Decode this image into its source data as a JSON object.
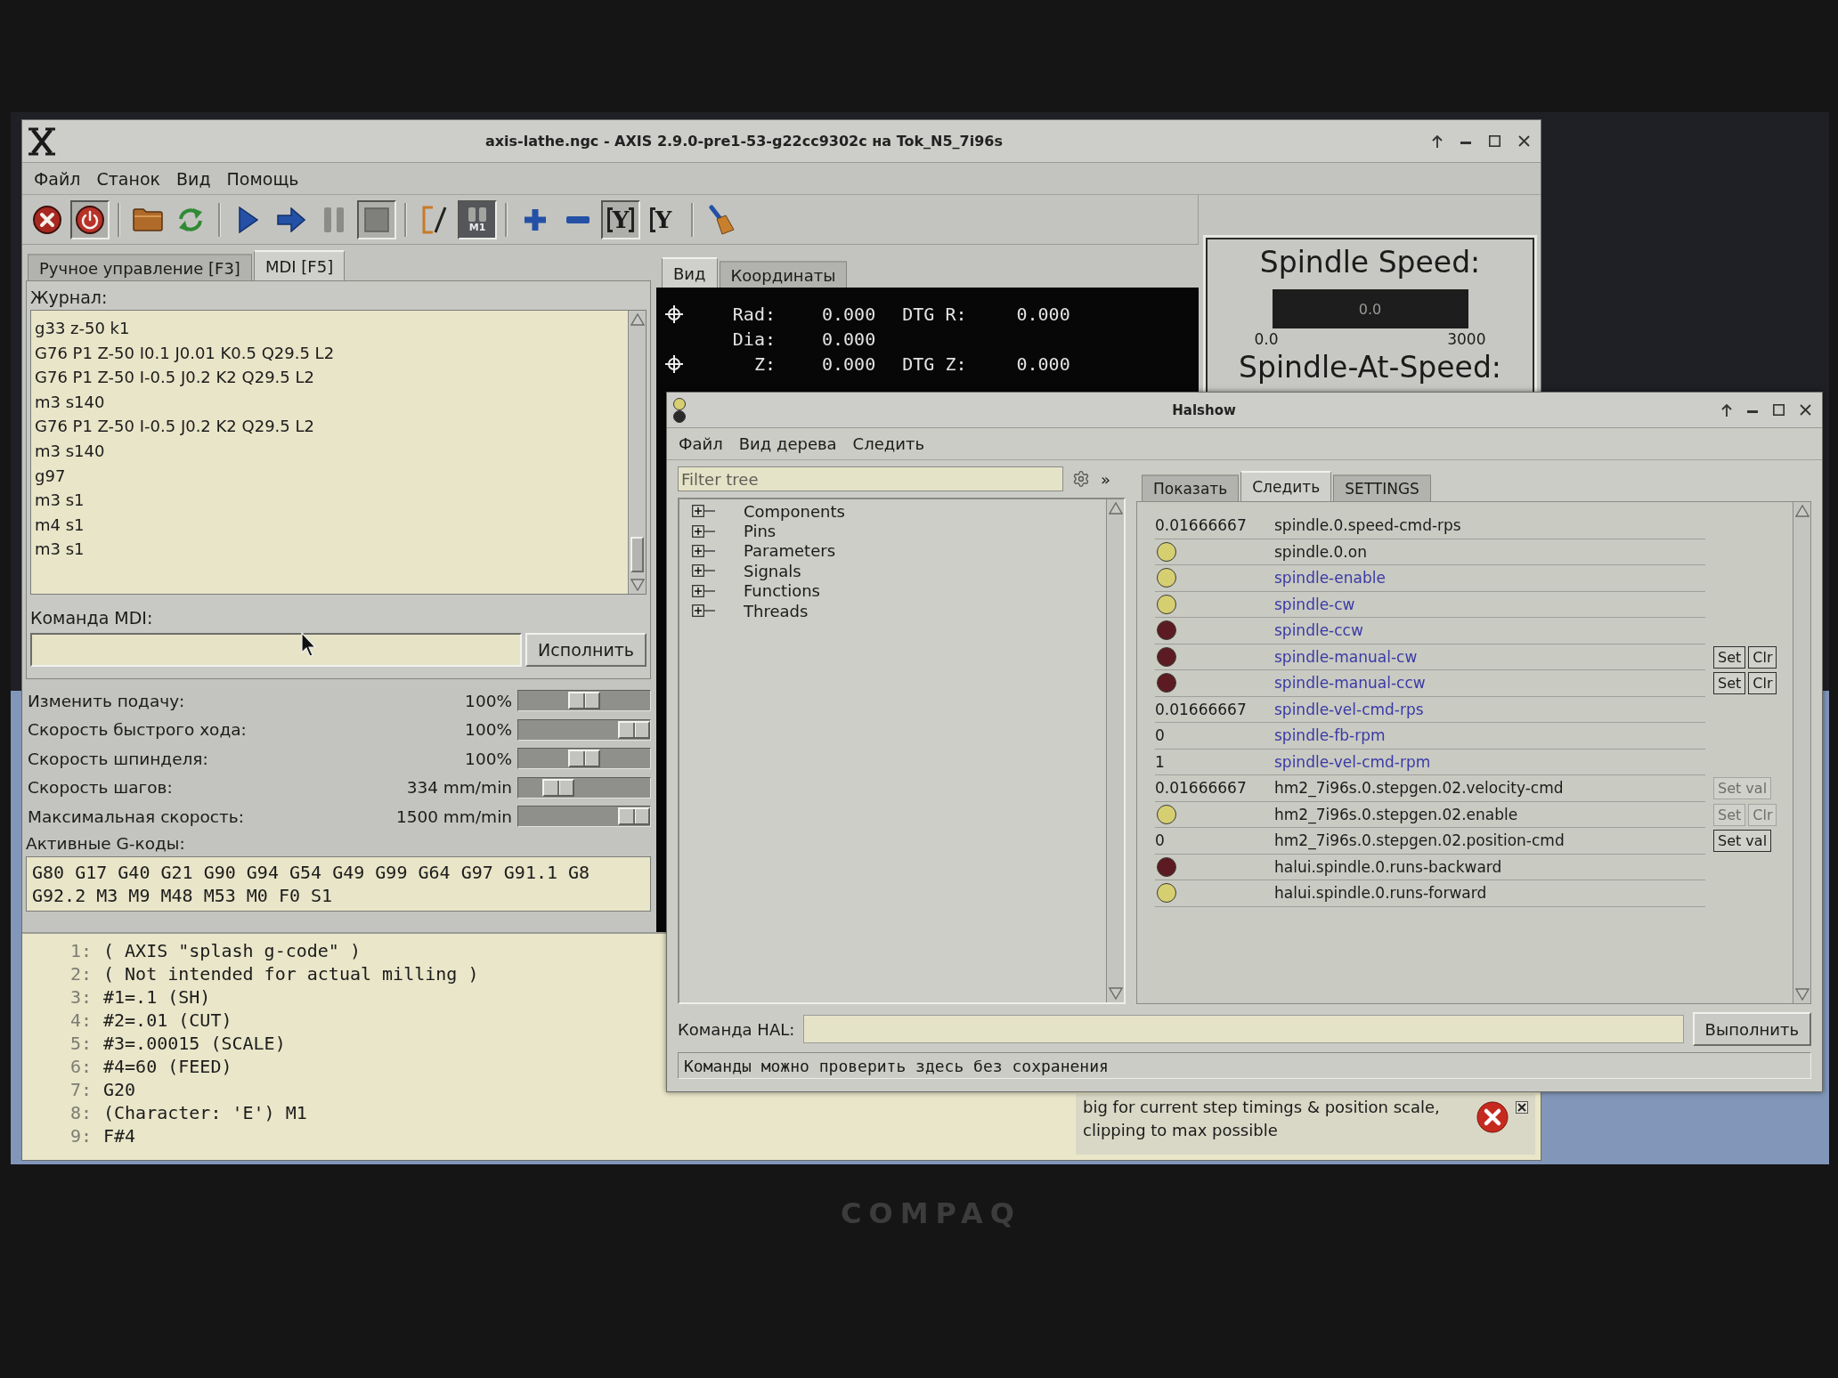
{
  "axis_window": {
    "title": "axis-lathe.ngc - AXIS 2.9.0-pre1-53-g22cc9302c на Tok_N5_7i96s",
    "menu": [
      "Файл",
      "Станок",
      "Вид",
      "Помощь"
    ],
    "toolbar_groups": [
      {
        "buttons": [
          {
            "kind": "estop",
            "pressed": false
          },
          {
            "kind": "power",
            "pressed": true
          }
        ]
      },
      {
        "buttons": [
          {
            "kind": "open",
            "pressed": false
          },
          {
            "kind": "reload",
            "pressed": false
          }
        ]
      },
      {
        "buttons": [
          {
            "kind": "run",
            "pressed": false
          },
          {
            "kind": "step",
            "pressed": false
          },
          {
            "kind": "pause",
            "pressed": false
          },
          {
            "kind": "stop",
            "pressed": true
          }
        ]
      },
      {
        "buttons": [
          {
            "kind": "block_delete",
            "pressed": false
          },
          {
            "kind": "optional_stop",
            "label": "M1",
            "pressed": true
          }
        ]
      },
      {
        "buttons": [
          {
            "kind": "zoom_in",
            "pressed": false
          },
          {
            "kind": "zoom_out",
            "pressed": false
          },
          {
            "kind": "view",
            "label": "Y",
            "pressed": true
          },
          {
            "kind": "view_rotated",
            "label": "Y",
            "pressed": false
          }
        ]
      },
      {
        "buttons": [
          {
            "kind": "clear",
            "pressed": false
          }
        ]
      }
    ],
    "left_tabs": [
      {
        "label": "Ручное управление [F3]",
        "selected": false
      },
      {
        "label": "MDI [F5]",
        "selected": true
      }
    ],
    "mdi": {
      "history_label": "Журнал:",
      "history": [
        "g33 z-50 k1",
        "G76 P1 Z-50 I0.1 J0.01 K0.5 Q29.5 L2",
        "G76 P1 Z-50 I-0.5 J0.2 K2 Q29.5 L2",
        "m3 s140",
        "G76 P1 Z-50 I-0.5 J0.2 K2 Q29.5 L2",
        "m3 s140",
        "g97",
        "m3 s1",
        "m4 s1",
        "m3 s1"
      ],
      "command_label": "Команда MDI:",
      "run_button": "Исполнить"
    },
    "sliders": [
      {
        "label": "Изменить подачу:",
        "reading": "100%",
        "level": 0.5
      },
      {
        "label": "Скорость быстрого хода:",
        "reading": "100%",
        "level": 1
      },
      {
        "label": "Скорость шпинделя:",
        "reading": "100%",
        "level": 0.5
      },
      {
        "label": "Скорость шагов:",
        "reading": "334 mm/min",
        "level": 0.24
      },
      {
        "label": "Максимальная скорость:",
        "reading": "1500 mm/min",
        "level": 1
      }
    ],
    "active_codes": {
      "label": "Активные G-коды:",
      "lines": [
        "G80 G17 G40 G21 G90 G94 G54 G49 G99 G64 G97 G91.1 G8",
        "G92.2 M3 M9 M48 M53 M0 F0 S1"
      ]
    },
    "right_tabs": [
      {
        "label": "Вид",
        "selected": true
      },
      {
        "label": "Координаты",
        "selected": false
      }
    ],
    "dro": [
      {
        "axis": "Rad:",
        "value": "0.000",
        "dtg_label": "DTG R:",
        "dtg_value": "0.000",
        "homed": true
      },
      {
        "axis": "Dia:",
        "value": "0.000",
        "homed": false
      },
      {
        "axis": "Z:",
        "value": "0.000",
        "dtg_label": "DTG Z:",
        "dtg_value": "0.000",
        "homed": true
      }
    ],
    "spindle_panel": {
      "title": "Spindle Speed:",
      "bar_text": "0.0",
      "level": 0,
      "scale_min": "0.0",
      "scale_max": "3000",
      "at_speed_label": "Spindle-At-Speed:"
    },
    "program_listing": [
      {
        "number": "1:",
        "text": "( AXIS \"splash g-code\" )"
      },
      {
        "number": "2:",
        "text": "( Not intended for actual milling )"
      },
      {
        "number": "3:",
        "text": "#1=.1 (SH)"
      },
      {
        "number": "4:",
        "text": "#2=.01 (CUT)"
      },
      {
        "number": "5:",
        "text": "#3=.00015 (SCALE)"
      },
      {
        "number": "6:",
        "text": "#4=60 (FEED)"
      },
      {
        "number": "7:",
        "text": "G20"
      },
      {
        "number": "8:",
        "text": "(Character: 'E') M1"
      },
      {
        "number": "9:",
        "text": "F#4"
      }
    ],
    "notification": {
      "lines": [
        "big for current step timings & position scale,",
        "clipping to max possible"
      ]
    }
  },
  "halshow_window": {
    "title": "Halshow",
    "menu": [
      "Файл",
      "Вид дерева",
      "Следить"
    ],
    "filter": {
      "placeholder": "Filter tree"
    },
    "expand_button": "»",
    "tree": [
      {
        "label": "Components",
        "expanded": false
      },
      {
        "label": "Pins",
        "expanded": false
      },
      {
        "label": "Parameters",
        "expanded": false
      },
      {
        "label": "Signals",
        "expanded": false
      },
      {
        "label": "Functions",
        "expanded": false
      },
      {
        "label": "Threads",
        "expanded": false
      }
    ],
    "tabs": [
      {
        "label": "Показать",
        "selected": false
      },
      {
        "label": "Следить",
        "selected": true
      },
      {
        "label": "SETTINGS",
        "selected": false
      }
    ],
    "watch": [
      {
        "kind": "value",
        "value": "0.01666667",
        "name": "spindle.0.speed-cmd-rps",
        "color": "#1b1b1b"
      },
      {
        "kind": "led",
        "on": true,
        "name": "spindle.0.on",
        "color": "#1b1b1b"
      },
      {
        "kind": "led",
        "on": true,
        "name": "spindle-enable",
        "color": "#3a3aa6"
      },
      {
        "kind": "led",
        "on": true,
        "name": "spindle-cw",
        "color": "#3a3aa6"
      },
      {
        "kind": "led",
        "on": false,
        "name": "spindle-ccw",
        "color": "#3a3aa6"
      },
      {
        "kind": "led",
        "on": false,
        "name": "spindle-manual-cw",
        "color": "#3a3aa6",
        "controls": [
          {
            "label": "Set",
            "disabled": false
          },
          {
            "label": "Clr",
            "disabled": false
          }
        ]
      },
      {
        "kind": "led",
        "on": false,
        "name": "spindle-manual-ccw",
        "color": "#3a3aa6",
        "controls": [
          {
            "label": "Set",
            "disabled": false
          },
          {
            "label": "Clr",
            "disabled": false
          }
        ]
      },
      {
        "kind": "value",
        "value": "0.01666667",
        "name": "spindle-vel-cmd-rps",
        "color": "#3a3aa6"
      },
      {
        "kind": "value",
        "value": "0",
        "name": "spindle-fb-rpm",
        "color": "#3a3aa6"
      },
      {
        "kind": "value",
        "value": "1",
        "name": "spindle-vel-cmd-rpm",
        "color": "#3a3aa6"
      },
      {
        "kind": "value",
        "value": "0.01666667",
        "name": "hm2_7i96s.0.stepgen.02.velocity-cmd",
        "color": "#1b1b1b",
        "controls": [
          {
            "label": "Set val",
            "disabled": true
          }
        ]
      },
      {
        "kind": "led",
        "on": true,
        "name": "hm2_7i96s.0.stepgen.02.enable",
        "color": "#1b1b1b",
        "controls": [
          {
            "label": "Set",
            "disabled": true
          },
          {
            "label": "Clr",
            "disabled": true
          }
        ]
      },
      {
        "kind": "value",
        "value": "0",
        "name": "hm2_7i96s.0.stepgen.02.position-cmd",
        "color": "#1b1b1b",
        "controls": [
          {
            "label": "Set val",
            "disabled": false
          }
        ]
      },
      {
        "kind": "led",
        "on": false,
        "name": "halui.spindle.0.runs-backward",
        "color": "#1b1b1b"
      },
      {
        "kind": "led",
        "on": true,
        "name": "halui.spindle.0.runs-forward",
        "color": "#1b1b1b"
      }
    ],
    "command": {
      "label": "Команда HAL:",
      "button": "Выполнить"
    },
    "status": "Команды можно проверить здесь без сохранения"
  },
  "bezel_logo": "COMPAQ"
}
